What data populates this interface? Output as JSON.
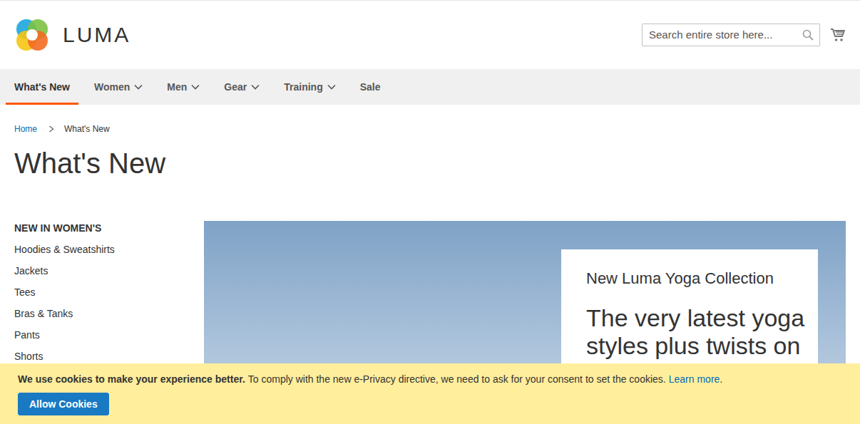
{
  "header": {
    "logo_text": "LUMA",
    "search": {
      "placeholder": "Search entire store here..."
    }
  },
  "nav": [
    {
      "label": "What's New",
      "selected": true,
      "has_menu": false
    },
    {
      "label": "Women",
      "selected": false,
      "has_menu": true
    },
    {
      "label": "Men",
      "selected": false,
      "has_menu": true
    },
    {
      "label": "Gear",
      "selected": false,
      "has_menu": true
    },
    {
      "label": "Training",
      "selected": false,
      "has_menu": true
    },
    {
      "label": "Sale",
      "selected": false,
      "has_menu": false
    }
  ],
  "breadcrumbs": [
    {
      "label": "Home",
      "is_link": true
    },
    {
      "label": "What's New",
      "is_link": false
    }
  ],
  "page_title": "What's New",
  "sidebar": {
    "heading": "NEW IN WOMEN'S",
    "items": [
      "Hoodies & Sweatshirts",
      "Jackets",
      "Tees",
      "Bras & Tanks",
      "Pants",
      "Shorts"
    ]
  },
  "hero": {
    "subtitle": "New Luma Yoga Collection",
    "title": "The very latest yoga styles plus twists on"
  },
  "cookie_notice": {
    "bold": "We use cookies to make your experience better.",
    "text": "To comply with the new e-Privacy directive, we need to ask for your consent to set the cookies.",
    "link": "Learn more",
    "end": ".",
    "button": "Allow Cookies"
  }
}
